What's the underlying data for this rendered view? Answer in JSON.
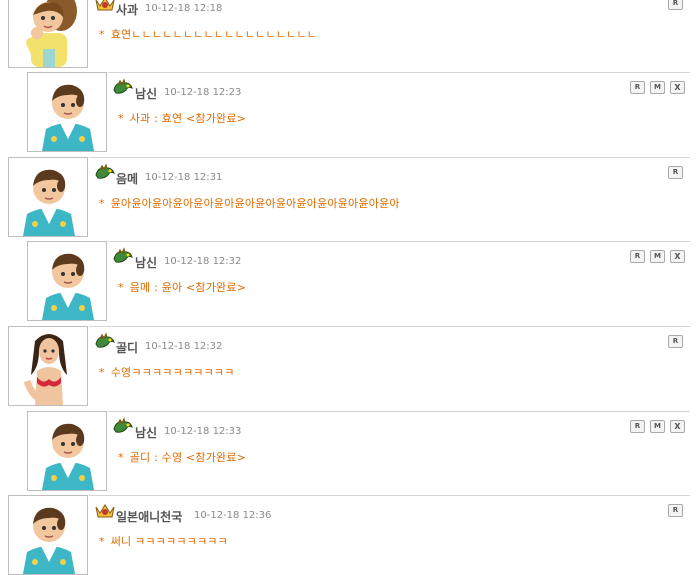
{
  "comments": [
    {
      "nick": "사과",
      "time": "10-12-18 12:18",
      "message": "효연ㄴㄴㄴㄴㄴㄴㄴㄴㄴㄴㄴㄴㄴㄴㄴㄴㄴㄴ",
      "reply": false,
      "avatar": "boy",
      "rank_icon": "crown-icon"
    },
    {
      "nick": "남신",
      "time": "10-12-18 12:23",
      "message": "사과 : 효연 <참가완료>",
      "reply": true,
      "avatar": "boy",
      "rank_icon": "dragon-icon"
    },
    {
      "nick": "음메",
      "time": "10-12-18 12:31",
      "message": "윤아윤아윤아윤아윤아윤아윤아윤아윤아윤아윤아윤아윤아윤아",
      "reply": false,
      "avatar": "boy",
      "rank_icon": "dragon-icon"
    },
    {
      "nick": "남신",
      "time": "10-12-18 12:32",
      "message": "음메 : 윤아 <참가완료>",
      "reply": true,
      "avatar": "boy",
      "rank_icon": "dragon-icon"
    },
    {
      "nick": "골디",
      "time": "10-12-18 12:32",
      "message": "수영ㅋㅋㅋㅋㅋㅋㅋㅋㅋㅋ",
      "reply": false,
      "avatar": "girl",
      "rank_icon": "dragon-icon"
    },
    {
      "nick": "남신",
      "time": "10-12-18 12:33",
      "message": "골디 : 수영 <참가완료>",
      "reply": true,
      "avatar": "boy",
      "rank_icon": "dragon-icon"
    },
    {
      "nick": "일본애니천국",
      "time": "10-12-18 12:36",
      "message": "써니 ㅋㅋㅋㅋㅋㅋㅋㅋㅋ",
      "reply": false,
      "avatar": "boy",
      "rank_icon": "crown-icon"
    }
  ],
  "labels": {
    "star": "*",
    "reply_button": "R",
    "modify_button": "M",
    "delete_button": "X"
  }
}
